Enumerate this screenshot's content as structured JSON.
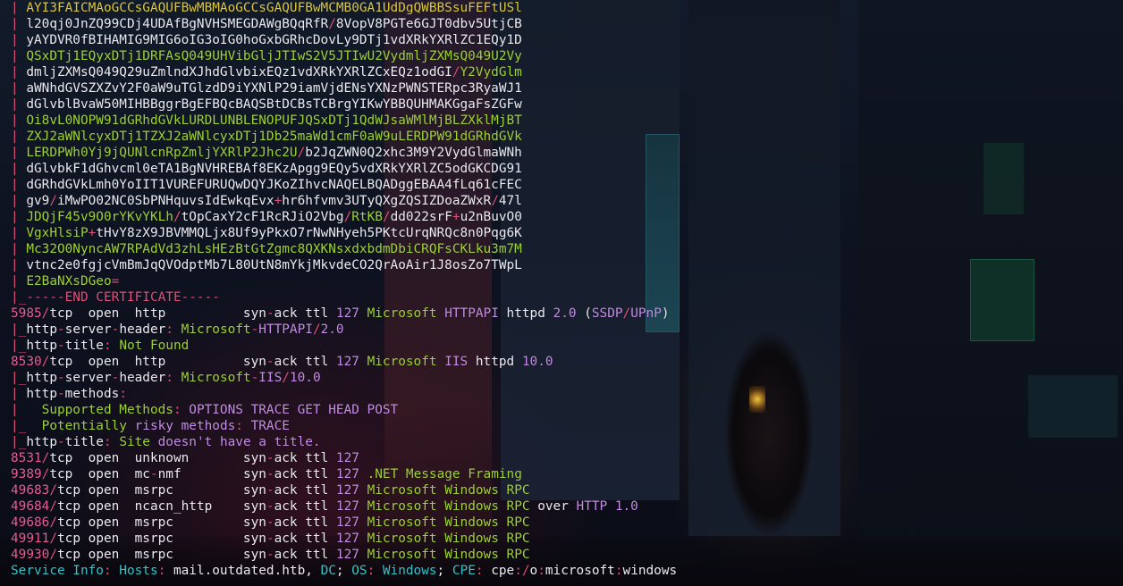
{
  "terminal": {
    "palette": {
      "pipe": "#e0507a",
      "green": "#9fd332",
      "pink": "#ea5c95",
      "yellow": "#dcc83a",
      "violet": "#c48ce6",
      "white": "#ecebf2",
      "cyan": "#35c4c8"
    },
    "lines": [
      [
        [
          "p",
          "| "
        ],
        [
          "y",
          "AYI3FAICMAoGCCsGAQUFBwMBMAoGCCsGAQUFBwMCMB0GA1UdDgQWBBSsuFEFtUSl"
        ]
      ],
      [
        [
          "p",
          "| "
        ],
        [
          "w",
          "l20qj0JnZQ99CDj4UDAfBgNVHSMEGDAWgBQqRfR"
        ],
        [
          "p",
          "/"
        ],
        [
          "w",
          "8VopV8PGTe6GJT0dbv5UtjCB"
        ]
      ],
      [
        [
          "p",
          "| "
        ],
        [
          "w",
          "yAYDVR0fBIHAMIG9MIG6oIG3oIG0hoGxbGRhcDovLy9DTj1vdXRkYXRlZC1EQy1D"
        ]
      ],
      [
        [
          "p",
          "| "
        ],
        [
          "g",
          "QSxDTj1EQyxDTj1DRFAsQ049UHVibGljJTIwS2V5JTIwU2VydmljZXMsQ049U2Vy"
        ]
      ],
      [
        [
          "p",
          "| "
        ],
        [
          "w",
          "dmljZXMsQ049Q29uZmlndXJhdGlvbixEQz1vdXRkYXRlZCxEQz1odGI"
        ],
        [
          "p",
          "/"
        ],
        [
          "g",
          "Y2VydGlm"
        ]
      ],
      [
        [
          "p",
          "| "
        ],
        [
          "w",
          "aWNhdGVSZXZvY2F0aW9uTGlzdD9iYXNlP29iamVjdENsYXNzPWNSTERpc3RyaWJ1"
        ]
      ],
      [
        [
          "p",
          "| "
        ],
        [
          "w",
          "dGlvblBvaW50MIHBBggrBgEFBQcBAQSBtDCBsTCBrgYIKwYBBQUHMAKGgaFsZGFw"
        ]
      ],
      [
        [
          "p",
          "| "
        ],
        [
          "g",
          "Oi8vL0NOPW91dGRhdGVkLURDLUNBLENOPUFJQSxDTj1QdWJsaWMlMjBLZXklMjBT"
        ]
      ],
      [
        [
          "p",
          "| "
        ],
        [
          "g",
          "ZXJ2aWNlcyxDTj1TZXJ2aWNlcyxDTj1Db25maWd1cmF0aW9uLERDPW91dGRhdGVk"
        ]
      ],
      [
        [
          "p",
          "| "
        ],
        [
          "g",
          "LERDPWh0Yj9jQUNlcnRpZmljYXRlP2Jhc2U"
        ],
        [
          "p",
          "/"
        ],
        [
          "w",
          "b2JqZWN0Q2xhc3M9Y2VydGlmaWNh"
        ]
      ],
      [
        [
          "p",
          "| "
        ],
        [
          "w",
          "dGlvbkF1dGhvcml0eTA1BgNVHREBAf8EKzApgg9EQy5vdXRkYXRlZC5odGKCDG91"
        ]
      ],
      [
        [
          "p",
          "| "
        ],
        [
          "w",
          "dGRhdGVkLmh0YoIIT1VUREFURUQwDQYJKoZIhvcNAQELBQADggEBAA4fLq61cFEC"
        ]
      ],
      [
        [
          "p",
          "| "
        ],
        [
          "w",
          "gv9"
        ],
        [
          "p",
          "/"
        ],
        [
          "w",
          "iMwPO02NC0SbPNHquvsIdEwkqEvx"
        ],
        [
          "p",
          "+"
        ],
        [
          "w",
          "hr6hfvmv3UTyQXgZQSIZDoaZWxR"
        ],
        [
          "p",
          "/"
        ],
        [
          "w",
          "47l"
        ]
      ],
      [
        [
          "p",
          "| "
        ],
        [
          "g",
          "JDQjF45v9O0rYKvYKLh"
        ],
        [
          "p",
          "/"
        ],
        [
          "w",
          "tOpCaxY2cF1RcRJiO2Vbg"
        ],
        [
          "p",
          "/"
        ],
        [
          "g",
          "RtKB"
        ],
        [
          "p",
          "/"
        ],
        [
          "w",
          "dd022srF"
        ],
        [
          "p",
          "+"
        ],
        [
          "w",
          "u2nBuvO0"
        ]
      ],
      [
        [
          "p",
          "| "
        ],
        [
          "g",
          "VgxHlsiP"
        ],
        [
          "p",
          "+"
        ],
        [
          "w",
          "tHvY8zX9JBVMMQLjx8Uf9yPkxO7rNwNHyeh5PKtcUrqNRQc8n0Pqg6K"
        ]
      ],
      [
        [
          "p",
          "| "
        ],
        [
          "g",
          "Mc32O0NyncAW7RPAdVd3zhLsHEzBtGtZgmc8QXKNsxdxbdmDbiCRQFsCKLku3m7M"
        ]
      ],
      [
        [
          "p",
          "| "
        ],
        [
          "w",
          "vtnc2e0fgjcVmBmJqQVOdptMb7L80UtN8mYkjMkvdeCO2QrAoAir1J8osZo7TWpL"
        ]
      ],
      [
        [
          "p",
          "| "
        ],
        [
          "g",
          "E2BaNXsDGeo"
        ],
        [
          "p",
          "="
        ]
      ],
      [
        [
          "p",
          "|_-----END CERTIFICATE-----"
        ]
      ],
      [
        [
          "m",
          "5985"
        ],
        [
          "p",
          "/"
        ],
        [
          "w",
          "tcp  open  http          syn"
        ],
        [
          "p",
          "-"
        ],
        [
          "w",
          "ack ttl "
        ],
        [
          "v",
          "127"
        ],
        [
          "w",
          " "
        ],
        [
          "g",
          "Microsoft"
        ],
        [
          "w",
          " "
        ],
        [
          "v",
          "HTTPAPI"
        ],
        [
          "w",
          " httpd "
        ],
        [
          "v",
          "2.0"
        ],
        [
          "w",
          " ("
        ],
        [
          "v",
          "SSDP"
        ],
        [
          "p",
          "/"
        ],
        [
          "v",
          "UPnP"
        ],
        [
          "w",
          ")"
        ]
      ],
      [
        [
          "p",
          "|_"
        ],
        [
          "w",
          "http"
        ],
        [
          "p",
          "-"
        ],
        [
          "w",
          "server"
        ],
        [
          "p",
          "-"
        ],
        [
          "w",
          "header"
        ],
        [
          "p",
          ": "
        ],
        [
          "g",
          "Microsoft"
        ],
        [
          "p",
          "-"
        ],
        [
          "v",
          "HTTPAPI"
        ],
        [
          "p",
          "/"
        ],
        [
          "v",
          "2.0"
        ]
      ],
      [
        [
          "p",
          "|_"
        ],
        [
          "w",
          "http"
        ],
        [
          "p",
          "-"
        ],
        [
          "w",
          "title"
        ],
        [
          "p",
          ": "
        ],
        [
          "g",
          "Not Found"
        ]
      ],
      [
        [
          "m",
          "8530"
        ],
        [
          "p",
          "/"
        ],
        [
          "w",
          "tcp  open  http          syn"
        ],
        [
          "p",
          "-"
        ],
        [
          "w",
          "ack ttl "
        ],
        [
          "v",
          "127"
        ],
        [
          "w",
          " "
        ],
        [
          "g",
          "Microsoft"
        ],
        [
          "w",
          " "
        ],
        [
          "v",
          "IIS"
        ],
        [
          "w",
          " httpd "
        ],
        [
          "v",
          "10.0"
        ]
      ],
      [
        [
          "p",
          "|_"
        ],
        [
          "w",
          "http"
        ],
        [
          "p",
          "-"
        ],
        [
          "w",
          "server"
        ],
        [
          "p",
          "-"
        ],
        [
          "w",
          "header"
        ],
        [
          "p",
          ": "
        ],
        [
          "g",
          "Microsoft"
        ],
        [
          "p",
          "-"
        ],
        [
          "v",
          "IIS"
        ],
        [
          "p",
          "/"
        ],
        [
          "v",
          "10.0"
        ]
      ],
      [
        [
          "p",
          "| "
        ],
        [
          "w",
          "http"
        ],
        [
          "p",
          "-"
        ],
        [
          "w",
          "methods"
        ],
        [
          "p",
          ":"
        ]
      ],
      [
        [
          "p",
          "|   "
        ],
        [
          "g",
          "Supported Methods"
        ],
        [
          "p",
          ": "
        ],
        [
          "v",
          "OPTIONS TRACE GET HEAD POST"
        ]
      ],
      [
        [
          "p",
          "|_  "
        ],
        [
          "g",
          "Potentially"
        ],
        [
          "w",
          " "
        ],
        [
          "v",
          "risky methods"
        ],
        [
          "p",
          ": "
        ],
        [
          "v",
          "TRACE"
        ]
      ],
      [
        [
          "p",
          "|_"
        ],
        [
          "w",
          "http"
        ],
        [
          "p",
          "-"
        ],
        [
          "w",
          "title"
        ],
        [
          "p",
          ": "
        ],
        [
          "g",
          "Site"
        ],
        [
          "w",
          " "
        ],
        [
          "v",
          "doesn't have a title."
        ]
      ],
      [
        [
          "m",
          "8531"
        ],
        [
          "p",
          "/"
        ],
        [
          "w",
          "tcp  open  unknown       syn"
        ],
        [
          "p",
          "-"
        ],
        [
          "w",
          "ack ttl "
        ],
        [
          "v",
          "127"
        ]
      ],
      [
        [
          "m",
          "9389"
        ],
        [
          "p",
          "/"
        ],
        [
          "w",
          "tcp  open  mc"
        ],
        [
          "p",
          "-"
        ],
        [
          "w",
          "nmf        syn"
        ],
        [
          "p",
          "-"
        ],
        [
          "w",
          "ack ttl "
        ],
        [
          "v",
          "127"
        ],
        [
          "w",
          " "
        ],
        [
          "g",
          ".NET Message Framing"
        ]
      ],
      [
        [
          "m",
          "49683"
        ],
        [
          "p",
          "/"
        ],
        [
          "w",
          "tcp open  msrpc         syn"
        ],
        [
          "p",
          "-"
        ],
        [
          "w",
          "ack ttl "
        ],
        [
          "v",
          "127"
        ],
        [
          "w",
          " "
        ],
        [
          "g",
          "Microsoft Windows RPC"
        ]
      ],
      [
        [
          "m",
          "49684"
        ],
        [
          "p",
          "/"
        ],
        [
          "w",
          "tcp open  ncacn_http    syn"
        ],
        [
          "p",
          "-"
        ],
        [
          "w",
          "ack ttl "
        ],
        [
          "v",
          "127"
        ],
        [
          "w",
          " "
        ],
        [
          "g",
          "Microsoft Windows RPC"
        ],
        [
          "w",
          " over "
        ],
        [
          "v",
          "HTTP 1.0"
        ]
      ],
      [
        [
          "m",
          "49686"
        ],
        [
          "p",
          "/"
        ],
        [
          "w",
          "tcp open  msrpc         syn"
        ],
        [
          "p",
          "-"
        ],
        [
          "w",
          "ack ttl "
        ],
        [
          "v",
          "127"
        ],
        [
          "w",
          " "
        ],
        [
          "g",
          "Microsoft Windows RPC"
        ]
      ],
      [
        [
          "m",
          "49911"
        ],
        [
          "p",
          "/"
        ],
        [
          "w",
          "tcp open  msrpc         syn"
        ],
        [
          "p",
          "-"
        ],
        [
          "w",
          "ack ttl "
        ],
        [
          "v",
          "127"
        ],
        [
          "w",
          " "
        ],
        [
          "g",
          "Microsoft Windows RPC"
        ]
      ],
      [
        [
          "m",
          "49930"
        ],
        [
          "p",
          "/"
        ],
        [
          "w",
          "tcp open  msrpc         syn"
        ],
        [
          "p",
          "-"
        ],
        [
          "w",
          "ack ttl "
        ],
        [
          "v",
          "127"
        ],
        [
          "w",
          " "
        ],
        [
          "g",
          "Microsoft Windows RPC"
        ]
      ],
      [
        [
          "c",
          "Service Info"
        ],
        [
          "p",
          ": "
        ],
        [
          "c",
          "Hosts"
        ],
        [
          "p",
          ": "
        ],
        [
          "w",
          "mail.outdated.htb, "
        ],
        [
          "c",
          "DC"
        ],
        [
          "w",
          "; "
        ],
        [
          "c",
          "OS"
        ],
        [
          "p",
          ": "
        ],
        [
          "c",
          "Windows"
        ],
        [
          "w",
          "; "
        ],
        [
          "c",
          "CPE"
        ],
        [
          "p",
          ": "
        ],
        [
          "w",
          "cpe"
        ],
        [
          "p",
          ":/"
        ],
        [
          "w",
          "o"
        ],
        [
          "p",
          ":"
        ],
        [
          "w",
          "microsoft"
        ],
        [
          "p",
          ":"
        ],
        [
          "w",
          "windows"
        ]
      ]
    ]
  }
}
